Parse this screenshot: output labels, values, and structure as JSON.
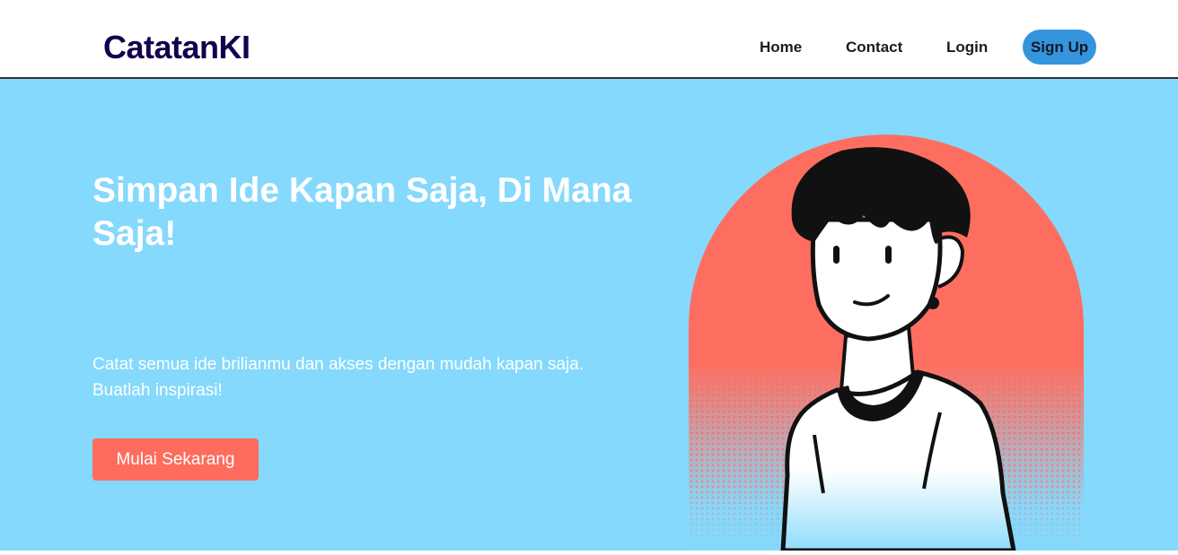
{
  "brand": {
    "name": "CatatanKI"
  },
  "nav": {
    "home": "Home",
    "contact": "Contact",
    "login": "Login",
    "signup": "Sign Up"
  },
  "hero": {
    "title": "Simpan Ide Kapan Saja, Di Mana Saja!",
    "subtitle_line1": "Catat semua ide brilianmu dan akses dengan mudah kapan saja.",
    "subtitle_line2": "Buatlah inspirasi!",
    "cta": "Mulai Sekarang"
  },
  "colors": {
    "hero_background": "#85d9fc",
    "brand_text": "#15004f",
    "signup_button": "#3595dc",
    "cta_button": "#fe6c5e",
    "illustration_arch": "#fe6e60"
  },
  "icons": {
    "illustration": "person-portrait-illustration"
  }
}
